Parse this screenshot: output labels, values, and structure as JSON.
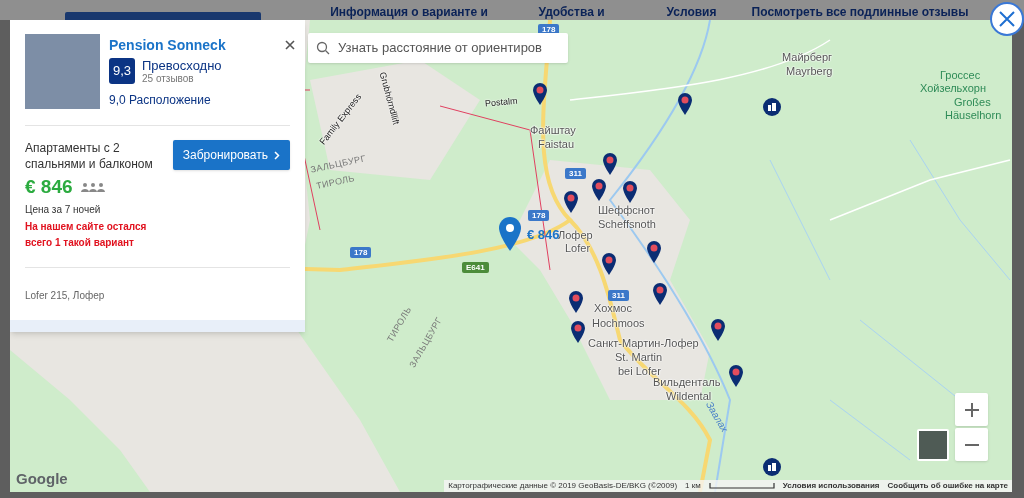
{
  "page_tabs": [
    "Информация о варианте и",
    "Удобства и",
    "Условия",
    "Посмотреть все подлинные отзывы"
  ],
  "card": {
    "title": "Pension Sonneck",
    "score": "9,3",
    "rating_word": "Превосходно",
    "reviews": "25 отзывов",
    "location_score": "9,0 Расположение",
    "room": "Апартаменты с 2 спальнями и балконом",
    "book_button": "Забронировать",
    "price": "€ 846",
    "price_note": "Цена за 7 ночей",
    "availability_warning": "На нашем сайте остался всего 1 такой вариант",
    "address": "Lofer 215, Лофер"
  },
  "map": {
    "search_placeholder": "Узнать расстояние от ориентиров",
    "labels": [
      {
        "text": "178",
        "kind": "road"
      },
      {
        "text": "Майрберг",
        "kind": "place"
      },
      {
        "text": "Mayrberg",
        "kind": "place"
      },
      {
        "text": "Гроссес",
        "kind": "peak"
      },
      {
        "text": "Хойзельхорн",
        "kind": "peak"
      },
      {
        "text": "Großes",
        "kind": "peak"
      },
      {
        "text": "Häuselhorn",
        "kind": "peak"
      },
      {
        "text": "Family Express",
        "kind": "lift"
      },
      {
        "text": "Grubhörndllift",
        "kind": "lift"
      },
      {
        "text": "Postalm",
        "kind": "lift"
      },
      {
        "text": "Файштау",
        "kind": "place"
      },
      {
        "text": "Faistau",
        "kind": "place"
      },
      {
        "text": "ЗАЛЬЦБУРГ",
        "kind": "region"
      },
      {
        "text": "ТИРОЛЬ",
        "kind": "region"
      },
      {
        "text": "311",
        "kind": "road"
      },
      {
        "text": "178",
        "kind": "road"
      },
      {
        "text": "Шеффснот",
        "kind": "place"
      },
      {
        "text": "Scheffsnoth",
        "kind": "place"
      },
      {
        "text": "Лофер",
        "kind": "place"
      },
      {
        "text": "Lofer",
        "kind": "place"
      },
      {
        "text": "178",
        "kind": "road"
      },
      {
        "text": "E641",
        "kind": "euroroad"
      },
      {
        "text": "ТИРОЛЬ",
        "kind": "region"
      },
      {
        "text": "ЗАЛЬЦБУРГ",
        "kind": "region"
      },
      {
        "text": "311",
        "kind": "road"
      },
      {
        "text": "Хохмос",
        "kind": "place"
      },
      {
        "text": "Hochmoos",
        "kind": "place"
      },
      {
        "text": "Санкт-Мартин-Лофер",
        "kind": "place"
      },
      {
        "text": "St. Martin",
        "kind": "place"
      },
      {
        "text": "bei Lofer",
        "kind": "place"
      },
      {
        "text": "Вильденталь",
        "kind": "place"
      },
      {
        "text": "Wildental",
        "kind": "place"
      },
      {
        "text": "Заалах",
        "kind": "river"
      }
    ],
    "price_pin": "€ 846",
    "logo": "Google",
    "attribution": "Картографические данные © 2019 GeoBasis-DE/BKG (©2009)",
    "scale": "1 км",
    "terms": "Условия использования",
    "report": "Сообщить об ошибке на карте"
  }
}
